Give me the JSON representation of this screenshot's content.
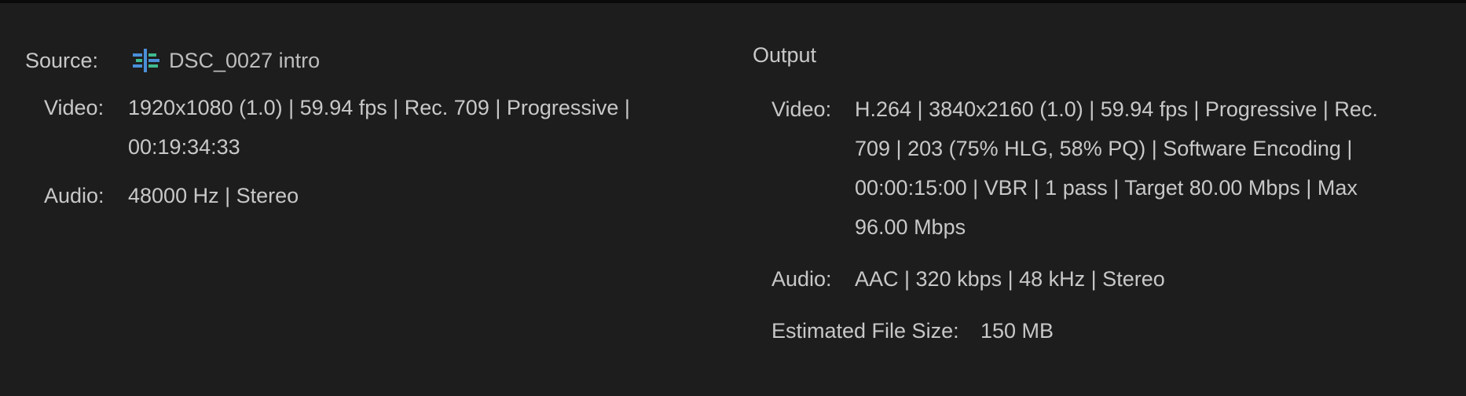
{
  "source": {
    "label": "Source:",
    "icon": "sequence-icon",
    "name": "DSC_0027 intro",
    "video_label": "Video:",
    "video_value": "1920x1080 (1.0) | 59.94 fps | Rec. 709 | Progressive | 00:19:34:33",
    "audio_label": "Audio:",
    "audio_value": "48000 Hz | Stereo"
  },
  "output": {
    "title": "Output",
    "video_label": "Video:",
    "video_value": "H.264 | 3840x2160 (1.0) | 59.94 fps | Progressive | Rec. 709 | 203 (75% HLG, 58% PQ) | Software Encoding | 00:00:15:00 | VBR | 1 pass | Target 80.00 Mbps | Max 96.00 Mbps",
    "audio_label": "Audio:",
    "audio_value": "AAC | 320 kbps | 48 kHz | Stereo",
    "filesize_label": "Estimated File Size:",
    "filesize_value": "150 MB"
  },
  "colors": {
    "background": "#1d1d1d",
    "text": "#c8c8c8",
    "icon_blue": "#4a8fd8",
    "icon_green": "#3fb98f"
  }
}
